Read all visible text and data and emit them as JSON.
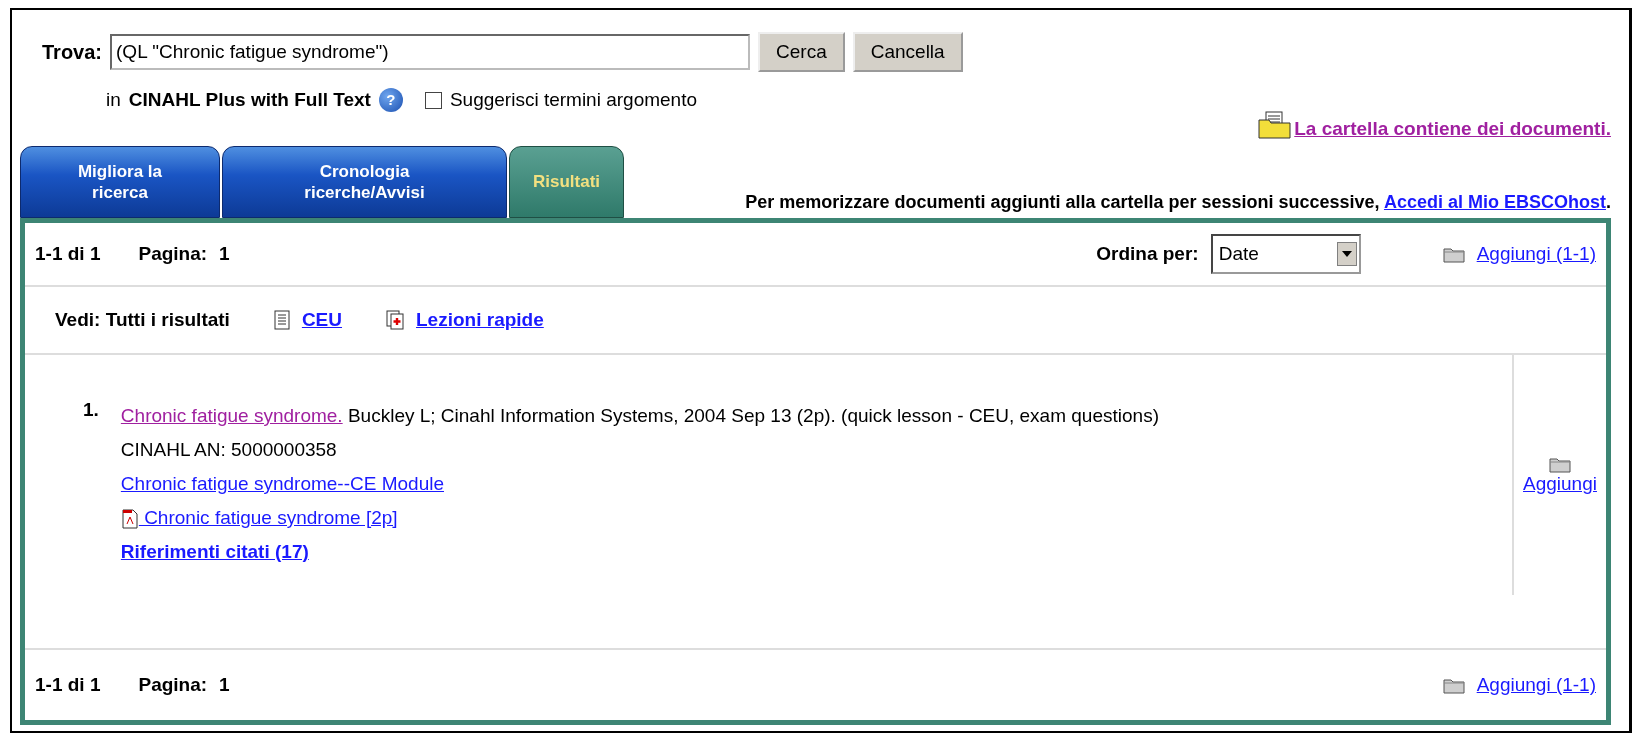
{
  "search": {
    "label": "Trova:",
    "value": "(QL \"Chronic fatigue syndrome\")",
    "buttons": [
      "Cerca",
      "Cancella"
    ]
  },
  "database": {
    "prefix": "in",
    "name": "CINAHL Plus with Full Text",
    "help": "?"
  },
  "suggest": {
    "label": "Suggerisci termini argomento",
    "checked": false
  },
  "folder_notice": "La cartella contiene dei documenti.",
  "tabs": [
    {
      "label": "Migliora la ricerca",
      "selected": false
    },
    {
      "label": "Cronologia ricerche/Avvisi",
      "selected": false
    },
    {
      "label": "Risultati",
      "selected": true
    }
  ],
  "login_note": {
    "text": "Per memorizzare documenti aggiunti alla cartella per sessioni successive,",
    "link": "Accedi al Mio EBSCOhost",
    "end": "."
  },
  "results_header": {
    "range": "1-1 di 1",
    "page_label": "Pagina:",
    "page": "1",
    "sort_label": "Ordina per:",
    "sort_value": "Date",
    "add_all": "Aggiungi (1-1)"
  },
  "view_bar": {
    "label": "Vedi: Tutti i risultati",
    "links": [
      {
        "kind": "list",
        "label": "CEU"
      },
      {
        "kind": "lesson",
        "label": "Lezioni rapide"
      }
    ]
  },
  "results": [
    {
      "number": "1.",
      "title": "Chronic fatigue syndrome.",
      "citation": "Buckley L; Cinahl Information Systems, 2004 Sep 13 (2p). (quick lesson - CEU, exam questions)",
      "accession": "CINAHL AN: 5000000358",
      "links": [
        {
          "kind": "plain",
          "label": "Chronic fatigue syndrome--CE Module"
        },
        {
          "kind": "pdf",
          "label": "Chronic fatigue syndrome [2p]"
        },
        {
          "kind": "bold",
          "label": "Riferimenti citati (17)"
        }
      ],
      "add": "Aggiungi"
    }
  ],
  "results_footer": {
    "range": "1-1 di 1",
    "page_label": "Pagina:",
    "page": "1",
    "add_all": "Aggiungi (1-1)"
  }
}
